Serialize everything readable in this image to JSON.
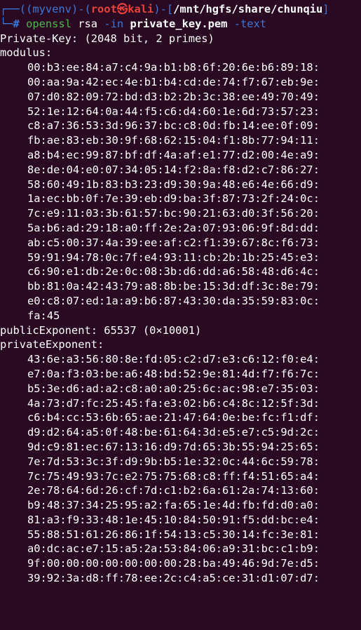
{
  "prompt": {
    "frame_open": "┌──(",
    "venv": "(myvenv)",
    "frame_mid": "-(",
    "user": "root",
    "at": "㉿",
    "host": "kali",
    "frame_path_open": ")-[",
    "path": "/mnt/hgfs/share/chunqiu",
    "frame_path_close": "]",
    "frame_cmd": "└─",
    "symbol": "#"
  },
  "command": {
    "program": "openssl",
    "subcommand": "rsa",
    "flag_in": "-in",
    "file": "private_key.pem",
    "flag_text": "-text"
  },
  "output": {
    "header": "Private-Key: (2048 bit, 2 primes)",
    "modulus_label": "modulus:",
    "modulus_lines": [
      "00:b3:ee:84:a7:c4:9a:b1:b8:6f:20:6e:b6:89:18:",
      "00:aa:9a:42:ec:4e:b1:b4:cd:de:74:f7:67:eb:9e:",
      "07:d0:82:09:72:bd:d3:b2:2b:3c:38:ee:49:70:49:",
      "52:1e:12:64:0a:44:f5:c6:d4:60:1e:6d:73:57:23:",
      "c8:a7:36:53:3d:96:37:bc:c8:0d:fb:14:ee:0f:09:",
      "fb:ae:83:eb:30:9f:68:62:15:04:f1:8b:77:94:11:",
      "a8:b4:ec:99:87:bf:df:4a:af:e1:77:d2:00:4e:a9:",
      "8e:de:04:e0:07:34:05:14:f2:8a:f8:d2:c7:86:27:",
      "58:60:49:1b:83:b3:23:d9:30:9a:48:e6:4e:66:d9:",
      "1a:ec:bb:0f:7e:39:eb:d9:ba:3f:87:73:2f:24:0c:",
      "7c:e9:11:03:3b:61:57:bc:90:21:63:d0:3f:56:20:",
      "5a:b6:ad:29:18:a0:ff:2e:2a:07:93:06:9f:8d:dd:",
      "ab:c5:00:37:4a:39:ee:af:c2:f1:39:67:8c:f6:73:",
      "59:91:94:78:0c:7f:e4:93:11:cb:2b:1b:25:45:e3:",
      "c6:90:e1:db:2e:0c:08:3b:d6:dd:a6:58:48:d6:4c:",
      "bb:81:0a:42:43:79:a8:8b:be:15:3d:df:3c:8e:79:",
      "e0:c8:07:ed:1a:a9:b6:87:43:30:da:35:59:83:0c:",
      "fa:45"
    ],
    "public_exponent": "publicExponent: 65537 (0×10001)",
    "private_exponent_label": "privateExponent:",
    "private_exponent_lines": [
      "43:6e:a3:56:80:8e:fd:05:c2:d7:e3:c6:12:f0:e4:",
      "e7:0a:f3:03:be:a6:48:bd:52:9e:81:4d:f7:f6:7c:",
      "b5:3e:d6:ad:a2:c8:a0:a0:25:6c:ac:98:e7:35:03:",
      "4a:73:d7:fc:25:45:fa:e3:02:b6:c4:8c:12:5f:3d:",
      "c6:b4:cc:53:6b:65:ae:21:47:64:0e:be:fc:f1:df:",
      "d9:d2:64:a5:0f:48:be:61:64:3d:e5:e7:c5:9d:2c:",
      "9d:c9:81:ec:67:13:16:d9:7d:65:3b:55:94:25:65:",
      "7e:7d:53:3c:3f:d9:9b:b5:1e:32:0c:44:6c:59:78:",
      "7c:75:49:93:7c:e2:75:75:68:c8:ff:f4:51:65:a4:",
      "2e:78:64:6d:26:cf:7d:c1:b2:6a:61:2a:74:13:60:",
      "b9:48:37:34:25:95:a2:fa:65:1e:4d:fb:fd:d0:a0:",
      "81:a3:f9:33:48:1e:45:10:84:50:91:f5:dd:bc:e4:",
      "55:88:51:61:26:86:1f:54:13:c5:30:14:fc:3e:81:",
      "a0:dc:ac:e7:15:a5:2a:53:84:06:a9:31:bc:c1:b9:",
      "9f:00:00:00:00:00:00:00:28:ba:49:46:9d:7e:d5:",
      "39:92:3a:d8:ff:78:ee:2c:c4:a5:ce:31:d1:07:d7:"
    ]
  },
  "colors": {
    "background": "#2a0a22",
    "frame": "#3d78d8",
    "user": "#e9423b",
    "command": "#4eb84e",
    "text": "#ffffff"
  }
}
